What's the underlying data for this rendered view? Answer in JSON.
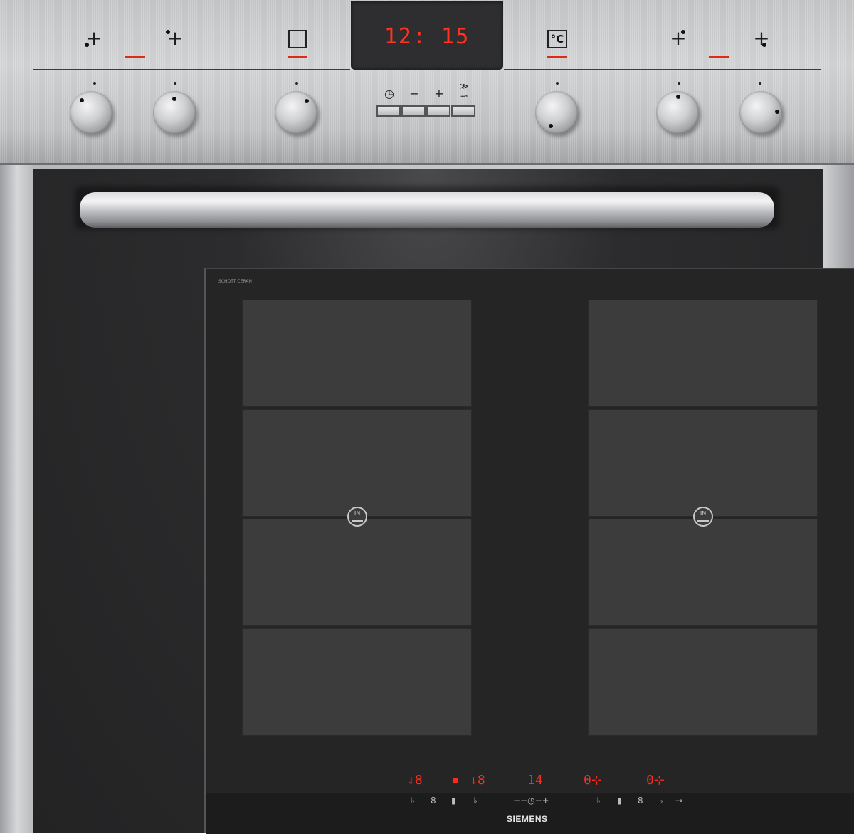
{
  "panel": {
    "clock": "12: 15",
    "function_symbols": [
      "⊹",
      "⊹",
      "⊹",
      "⊹"
    ],
    "temperature_symbol": "°C",
    "timer_buttons": [
      "◷",
      "−",
      "+",
      "≫"
    ],
    "timer_lock_symbol": "⊸",
    "accent_color": "#e02a18"
  },
  "hob": {
    "brand_small": "SCHOTT CERAN",
    "induction_label": "IN",
    "display_left_1": "⇃8",
    "display_left_2": "▪",
    "display_left_3": "⇂8",
    "display_center": "14",
    "display_right_1": "0⊹",
    "display_right_2": "0⊹",
    "touch_left": [
      "♭",
      "8",
      "▮",
      "♭"
    ],
    "touch_center": "−−◷−+",
    "touch_right": [
      "♭",
      "▮",
      "8",
      "♭",
      "⊸"
    ],
    "brand": "SIEMENS",
    "display_color": "#ff2a1a"
  }
}
